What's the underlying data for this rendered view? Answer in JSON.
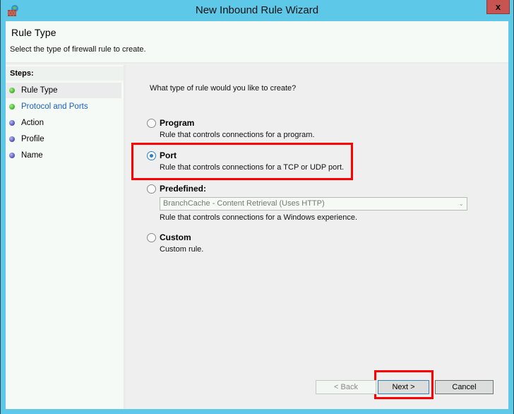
{
  "window": {
    "title": "New Inbound Rule Wizard",
    "close_label": "x",
    "icon": "firewall-icon"
  },
  "header": {
    "title": "Rule Type",
    "subtitle": "Select the type of firewall rule to create."
  },
  "steps": {
    "title": "Steps:",
    "items": [
      {
        "label": "Rule Type",
        "status": "done",
        "current": true
      },
      {
        "label": "Protocol and Ports",
        "status": "done",
        "current": false
      },
      {
        "label": "Action",
        "status": "pending",
        "current": false
      },
      {
        "label": "Profile",
        "status": "pending",
        "current": false
      },
      {
        "label": "Name",
        "status": "pending",
        "current": false
      }
    ]
  },
  "main": {
    "question": "What type of rule would you like to create?",
    "options": [
      {
        "label": "Program",
        "description": "Rule that controls connections for a program.",
        "selected": false
      },
      {
        "label": "Port",
        "description": "Rule that controls connections for a TCP or UDP port.",
        "selected": true
      },
      {
        "label": "Predefined:",
        "description": "Rule that controls connections for a Windows experience.",
        "selected": false
      },
      {
        "label": "Custom",
        "description": "Custom rule.",
        "selected": false
      }
    ],
    "predefined_select": {
      "value": "BranchCache - Content Retrieval (Uses HTTP)",
      "enabled": false
    }
  },
  "buttons": {
    "back": "< Back",
    "next": "Next >",
    "cancel": "Cancel"
  },
  "colors": {
    "frame": "#5ec8e8",
    "close": "#c75450",
    "highlight": "#ff0000",
    "link": "#1a62b8"
  }
}
